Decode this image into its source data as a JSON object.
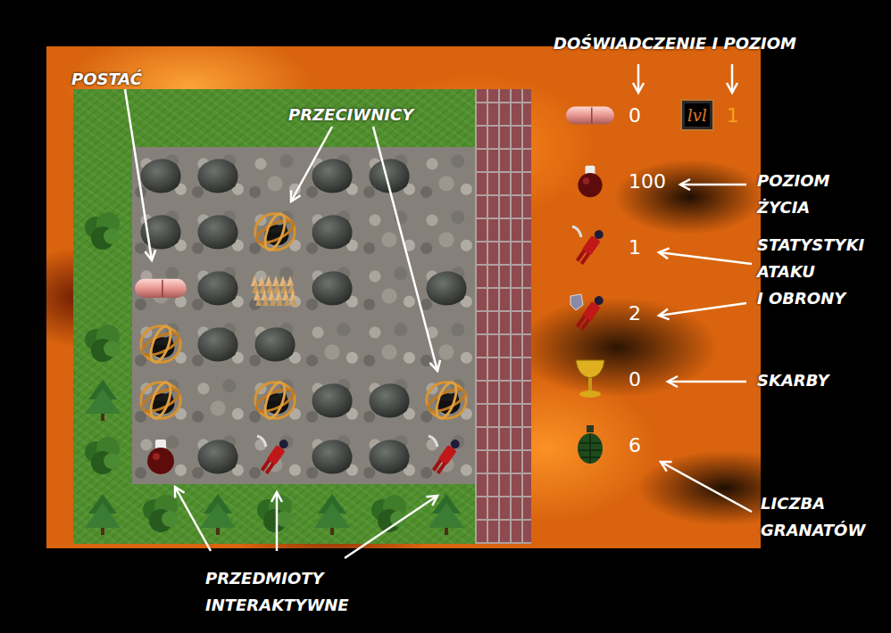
{
  "annotations": [
    {
      "id": "experience",
      "lines": [
        "DOŚWIADCZENIE I POZIOM"
      ]
    },
    {
      "id": "character",
      "lines": [
        "POSTAĆ"
      ]
    },
    {
      "id": "enemies",
      "lines": [
        "PRZECIWNICY"
      ]
    },
    {
      "id": "health",
      "lines": [
        "POZIOM",
        "ŻYCIA"
      ]
    },
    {
      "id": "stats",
      "lines": [
        "STATYSTYKI",
        "ATAKU",
        "I OBRONY"
      ]
    },
    {
      "id": "treasure",
      "lines": [
        "SKARBY"
      ]
    },
    {
      "id": "grenades",
      "lines": [
        "LICZBA",
        "GRANATÓW"
      ]
    },
    {
      "id": "items",
      "lines": [
        "PRZEDMIOTY",
        "INTERAKTYWNE"
      ]
    }
  ],
  "board": {
    "top_border": [
      "grass",
      "grass",
      "grass",
      "grass",
      "grass",
      "grass",
      "grass"
    ],
    "left_border": [
      "grass",
      "tree",
      "grass",
      "tree",
      "tree",
      "tree"
    ],
    "bottom_border": [
      "tree",
      "tree",
      "tree",
      "tree",
      "tree",
      "tree",
      "tree"
    ],
    "cells": [
      [
        "rock",
        "rock",
        "empty",
        "rock",
        "rock",
        "empty"
      ],
      [
        "rock",
        "rock",
        "enemy",
        "rock",
        "empty",
        "empty"
      ],
      [
        "player",
        "rock",
        "spikes",
        "rock",
        "empty",
        "rock"
      ],
      [
        "enemy",
        "rock",
        "rock",
        "empty",
        "empty",
        "empty"
      ],
      [
        "enemy",
        "empty",
        "enemy",
        "rock",
        "rock",
        "enemy"
      ],
      [
        "potion",
        "rock",
        "weapon",
        "rock",
        "rock",
        "weapon"
      ]
    ]
  },
  "stats": [
    {
      "kind": "experience",
      "value": "0"
    },
    {
      "kind": "health",
      "value": "100"
    },
    {
      "kind": "attack",
      "value": "1"
    },
    {
      "kind": "defense",
      "value": "2"
    },
    {
      "kind": "treasure",
      "value": "0"
    },
    {
      "kind": "grenades",
      "value": "6"
    }
  ],
  "level": {
    "badge": "lvl",
    "value": "1"
  }
}
